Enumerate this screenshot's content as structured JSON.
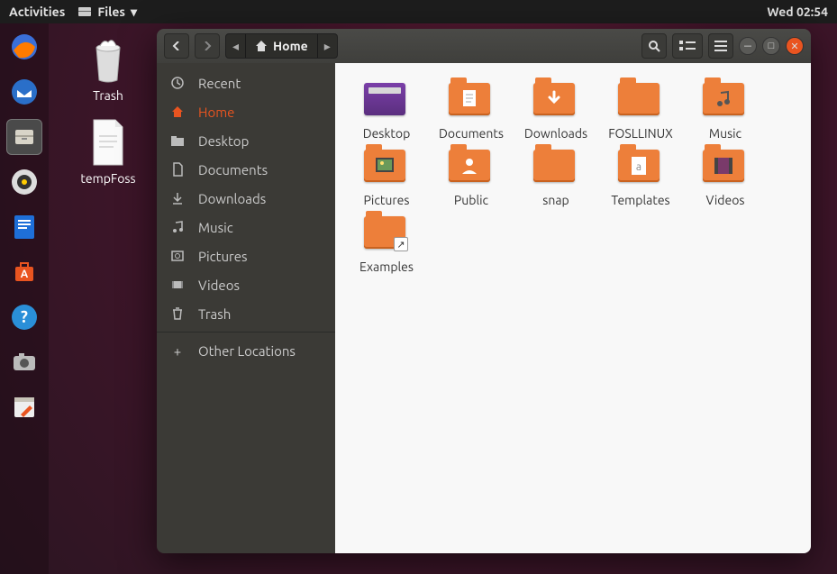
{
  "topbar": {
    "activities": "Activities",
    "files_menu": "Files",
    "clock": "Wed 02:54"
  },
  "desktop": {
    "items": [
      {
        "label": "Trash"
      },
      {
        "label": "tempFoss"
      }
    ]
  },
  "window": {
    "path_label": "Home",
    "sidebar": [
      {
        "label": "Recent",
        "icon": "clock"
      },
      {
        "label": "Home",
        "icon": "home",
        "active": true
      },
      {
        "label": "Desktop",
        "icon": "folder"
      },
      {
        "label": "Documents",
        "icon": "doc"
      },
      {
        "label": "Downloads",
        "icon": "down"
      },
      {
        "label": "Music",
        "icon": "music"
      },
      {
        "label": "Pictures",
        "icon": "pic"
      },
      {
        "label": "Videos",
        "icon": "vid"
      },
      {
        "label": "Trash",
        "icon": "trash"
      }
    ],
    "other_locations": "Other Locations",
    "folders": [
      {
        "label": "Desktop",
        "type": "desktop"
      },
      {
        "label": "Documents",
        "type": "folder",
        "emblem": "doc"
      },
      {
        "label": "Downloads",
        "type": "folder",
        "emblem": "down"
      },
      {
        "label": "FOSLLINUX",
        "type": "folder",
        "emblem": ""
      },
      {
        "label": "Music",
        "type": "folder",
        "emblem": "music"
      },
      {
        "label": "Pictures",
        "type": "folder",
        "emblem": "pic"
      },
      {
        "label": "Public",
        "type": "folder",
        "emblem": "public"
      },
      {
        "label": "snap",
        "type": "folder",
        "emblem": ""
      },
      {
        "label": "Templates",
        "type": "folder",
        "emblem": "tmpl"
      },
      {
        "label": "Videos",
        "type": "folder",
        "emblem": "vid"
      },
      {
        "label": "Examples",
        "type": "folder",
        "emblem": "",
        "link": true
      }
    ]
  }
}
